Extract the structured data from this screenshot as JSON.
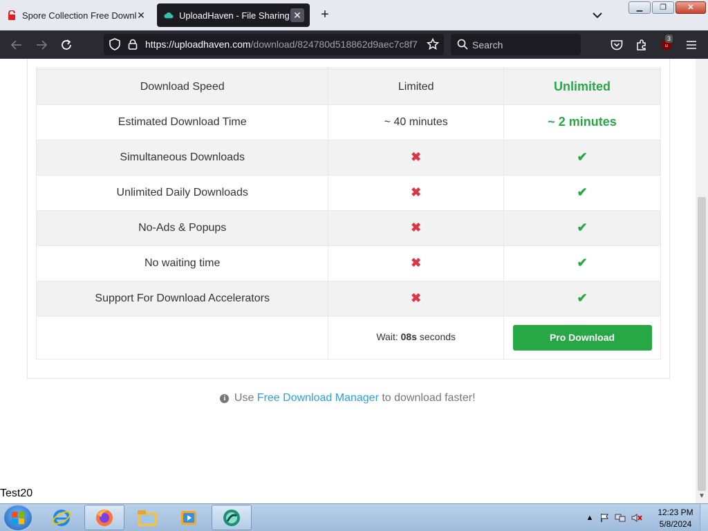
{
  "browser": {
    "tabs": [
      {
        "title": "Spore Collection Free Download",
        "active": false
      },
      {
        "title": "UploadHaven - File Sharing Made Simple",
        "active": true
      }
    ],
    "url_host": "https://uploadhaven.com",
    "url_path": "/download/824780d518862d9aec7c8f7",
    "search_placeholder": "Search",
    "addon_badge": "3"
  },
  "comparison": {
    "rows": [
      {
        "feature": "Download Speed",
        "free": "Limited",
        "pro": "Unlimited",
        "type": "text"
      },
      {
        "feature": "Estimated Download Time",
        "free": "~ 40 minutes",
        "pro": "~ 2 minutes",
        "type": "text"
      },
      {
        "feature": "Simultaneous Downloads",
        "free": "✖",
        "pro": "✔",
        "type": "mark"
      },
      {
        "feature": "Unlimited Daily Downloads",
        "free": "✖",
        "pro": "✔",
        "type": "mark"
      },
      {
        "feature": "No-Ads & Popups",
        "free": "✖",
        "pro": "✔",
        "type": "mark"
      },
      {
        "feature": "No waiting time",
        "free": "✖",
        "pro": "✔",
        "type": "mark"
      },
      {
        "feature": "Support For Download Accelerators",
        "free": "✖",
        "pro": "✔",
        "type": "mark"
      }
    ],
    "wait_prefix": "Wait:",
    "wait_seconds": "08s",
    "wait_suffix": "seconds",
    "pro_button": "Pro Download"
  },
  "fdm_note": {
    "prefix": "Use",
    "link": "Free Download Manager",
    "suffix": "to download faster!"
  },
  "overlay_label": "Test20",
  "taskbar": {
    "time": "12:23 PM",
    "date": "5/8/2024",
    "apps": [
      "internet-explorer-icon",
      "firefox-icon",
      "file-explorer-icon",
      "media-player-icon",
      "app-icon"
    ]
  },
  "colors": {
    "pro_green": "#28a745",
    "cross_red": "#dc3545",
    "link_blue": "#2f9fd8"
  }
}
